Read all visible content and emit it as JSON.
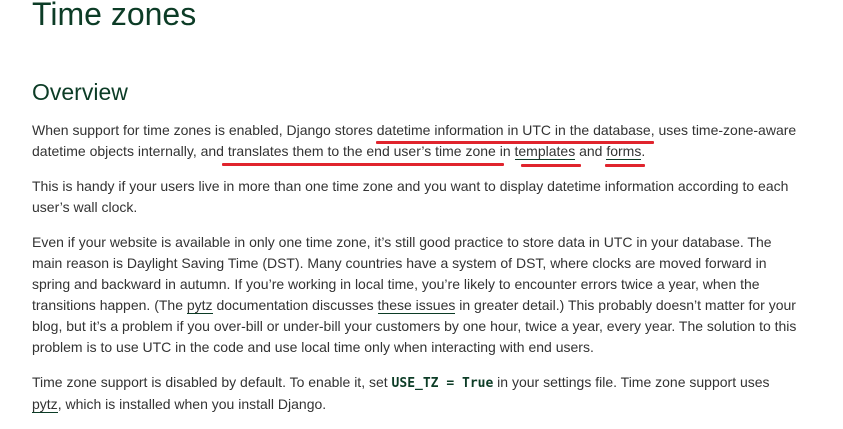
{
  "page_title": "Time zones",
  "section_title": "Overview",
  "annotation_color": "#e0242d",
  "p1": {
    "t1": "When support for time zones is enabled, Django stores ",
    "t2": "datetime information in UTC in the database",
    "t3": ", uses time-zone-aware datetime objects internally, and ",
    "t4": "translates them to the end user’s time zone in ",
    "link_templates": "templates",
    "t5": " and ",
    "link_forms": "forms",
    "t6": "."
  },
  "p2": {
    "text": "This is handy if your users live in more than one time zone and you want to display datetime information according to each user’s wall clock."
  },
  "p3": {
    "t1": "Even if your website is available in only one time zone, it’s still good practice to store data in UTC in your database. The main reason is Daylight Saving Time (DST). Many countries have a system of DST, where clocks are moved forward in spring and backward in autumn. If you’re working in local time, you’re likely to encounter errors twice a year, when the transitions happen. (The ",
    "link_pytz": "pytz",
    "t2": " documentation discusses ",
    "link_issues": "these issues",
    "t3": " in greater detail.) This probably doesn’t matter for your blog, but it’s a problem if you over-bill or under-bill your customers by one hour, twice a year, every year. The solution to this problem is to use UTC in the code and use local time only when interacting with end users."
  },
  "p4": {
    "t1": "Time zone support is disabled by default. To enable it, set ",
    "code": "USE_TZ = True",
    "t2": " in your settings file. Time zone support uses ",
    "link_pytz": "pytz",
    "t3": ", which is installed when you install Django."
  }
}
